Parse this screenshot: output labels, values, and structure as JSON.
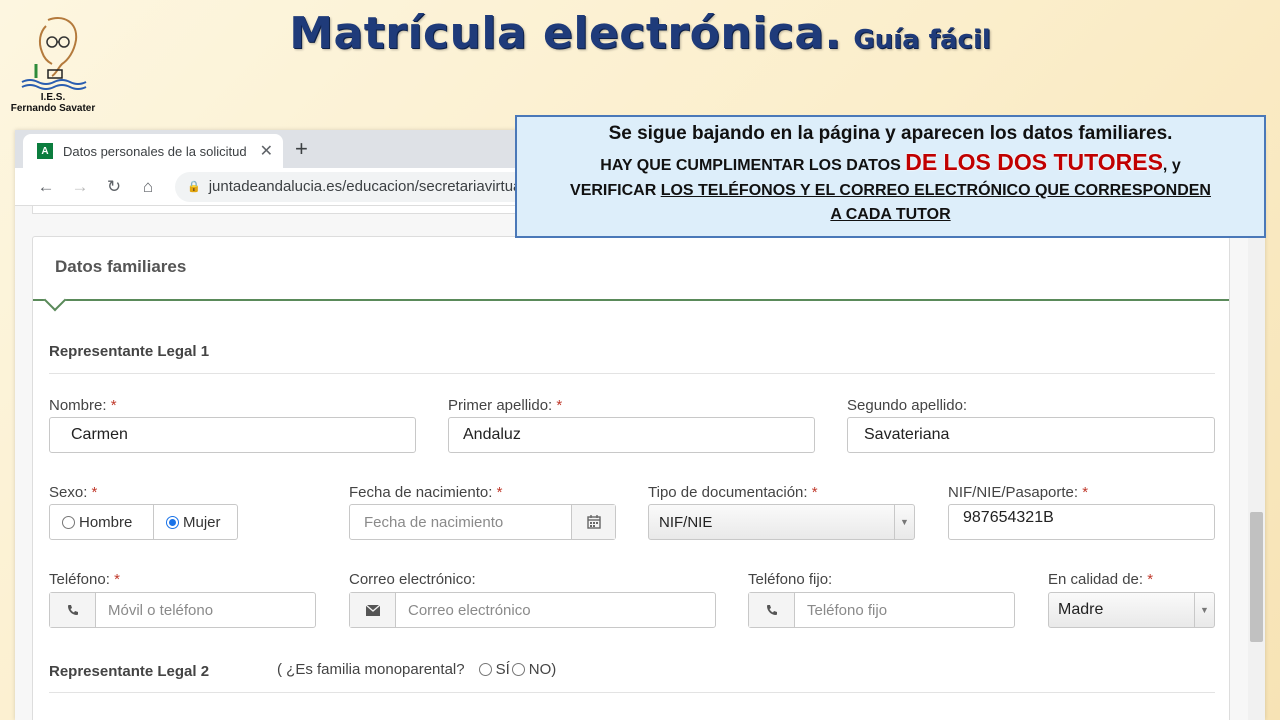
{
  "slide": {
    "title_main": "Matrícula electrónica.",
    "title_sub": "Guía fácil",
    "logo_line1": "I.E.S.",
    "logo_line2": "Fernando Savater"
  },
  "browser": {
    "tab_title": "Datos personales de la solicitud",
    "favicon_letter": "A",
    "url": "juntadeandalucia.es/educacion/secretariavirtual"
  },
  "callout": {
    "line1": "Se sigue bajando en la página y aparecen los datos familiares.",
    "line2_pre": "HAY QUE CUMPLIMENTAR  LOS DATOS ",
    "line2_red": "DE LOS DOS TUTORES",
    "line2_post": ", y",
    "line3_pre": "VERIFICAR  ",
    "line3_underlined": "LOS TELÉFONOS Y EL CORREO ELECTRÓNICO QUE CORRESPONDEN",
    "line4_underlined": "A CADA TUTOR"
  },
  "form": {
    "panel_title": "Datos familiares",
    "rep1_title": "Representante Legal 1",
    "nombre_label": "Nombre:",
    "nombre_value": "Carmen",
    "apellido1_label": "Primer apellido:",
    "apellido1_value": "Andaluz",
    "apellido2_label": "Segundo apellido:",
    "apellido2_value": "Savateriana",
    "sexo_label": "Sexo:",
    "sexo_options": [
      "Hombre",
      "Mujer"
    ],
    "sexo_selected": "Mujer",
    "fecha_label": "Fecha de nacimiento:",
    "fecha_placeholder": "Fecha de nacimiento",
    "tipo_doc_label": "Tipo de documentación:",
    "tipo_doc_value": "NIF/NIE",
    "nif_label": "NIF/NIE/Pasaporte:",
    "nif_value": "987654321B",
    "telefono_label": "Teléfono:",
    "telefono_placeholder": "Móvil o teléfono",
    "correo_label": "Correo electrónico:",
    "correo_placeholder": "Correo electrónico",
    "fijo_label": "Teléfono fijo:",
    "fijo_placeholder": "Teléfono fijo",
    "calidad_label": "En calidad de:",
    "calidad_value": "Madre",
    "required_mark": "*",
    "rep2_title": "Representante Legal 2",
    "monoparental_q_open": "( ¿Es familia monoparental?",
    "monoparental_si": "SÍ",
    "monoparental_no": "NO)"
  },
  "icons": {
    "phone": "phone-icon",
    "mail": "envelope-icon",
    "calendar": "calendar-icon",
    "lock": "lock-icon"
  }
}
